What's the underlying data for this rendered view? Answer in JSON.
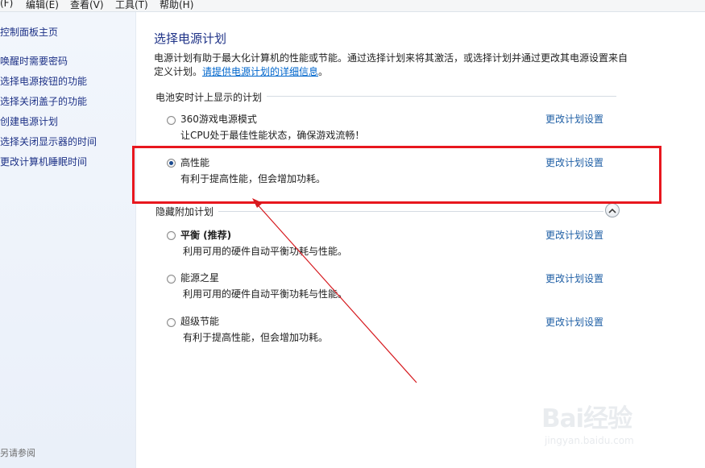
{
  "menubar": {
    "items": [
      "(F)",
      "编辑(E)",
      "查看(V)",
      "工具(T)",
      "帮助(H)"
    ]
  },
  "sidebar": {
    "items": [
      {
        "label": "控制面板主页"
      },
      {
        "label": "唤醒时需要密码"
      },
      {
        "label": "选择电源按钮的功能"
      },
      {
        "label": "选择关闭盖子的功能"
      },
      {
        "label": "创建电源计划"
      },
      {
        "label": "选择关闭显示器的时间"
      },
      {
        "label": "更改计算机睡眠时间"
      }
    ],
    "see_also": "另请参阅"
  },
  "main": {
    "title": "选择电源计划",
    "intro_text": "电源计划有助于最大化计算机的性能或节能。通过选择计划来将其激活，或选择计划并通过更改其电源设置来自定义计划。",
    "intro_link": "请提供电源计划的详细信息",
    "intro_end": "。",
    "group_battery": "电池安时计上显示的计划",
    "group_hidden": "隐藏附加计划",
    "change_link_label": "更改计划设置",
    "plans": [
      {
        "name": "360游戏电源模式",
        "desc": "让CPU处于最佳性能状态，确保游戏流畅！",
        "checked": false,
        "bold": false
      },
      {
        "name": "高性能",
        "desc": "有利于提高性能，但会增加功耗。",
        "checked": true,
        "bold": false
      },
      {
        "name": "平衡 (推荐)",
        "desc": "利用可用的硬件自动平衡功耗与性能。",
        "checked": false,
        "bold": true
      },
      {
        "name": "能源之星",
        "desc": "利用可用的硬件自动平衡功耗与性能。",
        "checked": false,
        "bold": false
      },
      {
        "name": "超级节能",
        "desc": "有利于提高性能，但会增加功耗。",
        "checked": false,
        "bold": false
      }
    ]
  },
  "icons": {
    "collapse": "chevron-up-icon",
    "radio": "radio-button"
  },
  "annotation_color": "#e8171e",
  "watermark": {
    "main": "Bai经验",
    "sub": "jingyan.baidu.com"
  }
}
